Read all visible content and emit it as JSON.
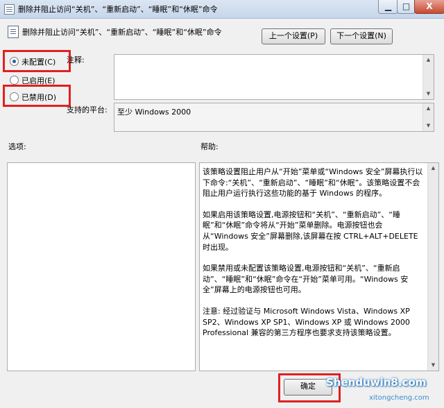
{
  "window": {
    "title": "删除并阻止访问“关机”、“重新启动”、“睡眠”和“休眠”命令",
    "min_label": "▁",
    "max_label": "□",
    "close_label": "X"
  },
  "header": {
    "policy_name": "删除并阻止访问“关机”、“重新启动”、“睡眠”和“休眠”命令",
    "prev_button": "上一个设置(P)",
    "next_button": "下一个设置(N)"
  },
  "options": {
    "selected": "not_configured",
    "items": [
      {
        "key": "not_configured",
        "label": "未配置(C)"
      },
      {
        "key": "enabled",
        "label": "已启用(E)"
      },
      {
        "key": "disabled",
        "label": "已禁用(D)"
      }
    ]
  },
  "comment": {
    "label": "注释:",
    "value": ""
  },
  "platform": {
    "label": "支持的平台:",
    "value": "至少 Windows 2000"
  },
  "sections": {
    "options_label": "选项:",
    "help_label": "帮助:"
  },
  "help": {
    "paragraphs": [
      "该策略设置阻止用户从“开始”菜单或“Windows 安全”屏幕执行以下命令:“关机”、“重新启动”、“睡眠”和“休眠”。该策略设置不会阻止用户运行执行这些功能的基于 Windows 的程序。",
      "如果启用该策略设置,电源按钮和“关机”、“重新启动”、“睡眠”和“休眠”命令将从“开始”菜单删除。电源按钮也会从“Windows 安全”屏幕删除,该屏幕在按 CTRL+ALT+DELETE 时出现。",
      "如果禁用或未配置该策略设置,电源按钮和“关机”、“重新启动”、“睡眠”和“休眠”命令在“开始”菜单可用。“Windows 安全”屏幕上的电源按钮也可用。",
      "注意: 经过验证与 Microsoft Windows Vista、Windows XP SP2、Windows XP SP1、Windows XP 或 Windows 2000 Professional 兼容的第三方程序也要求支持该策略设置。"
    ]
  },
  "footer": {
    "ok_button": "确定"
  },
  "watermark": {
    "main": "Shenduwin8.com",
    "sub": "xitongcheng.com"
  },
  "colors": {
    "highlight_border": "#e02020",
    "radio_dot": "#2b5f9e"
  }
}
